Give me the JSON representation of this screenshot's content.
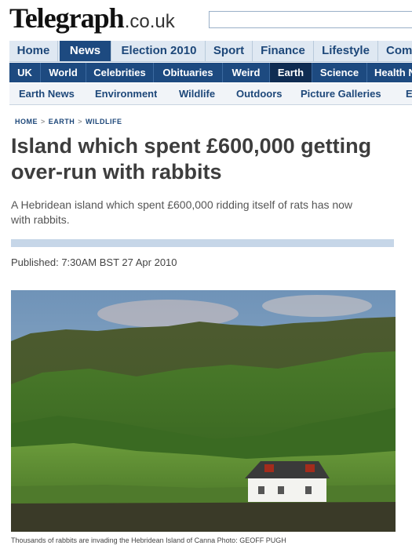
{
  "masthead": {
    "logo_text": "Telegraph",
    "logo_tld": ".co.uk",
    "search": {
      "value": "",
      "placeholder": ""
    }
  },
  "nav_primary": [
    {
      "label": "Home",
      "active": false
    },
    {
      "label": "News",
      "active": true
    },
    {
      "label": "Election 2010",
      "active": false
    },
    {
      "label": "Sport",
      "active": false
    },
    {
      "label": "Finance",
      "active": false
    },
    {
      "label": "Lifestyle",
      "active": false
    },
    {
      "label": "Comm",
      "active": false
    }
  ],
  "nav_secondary": [
    {
      "label": "UK",
      "active": false
    },
    {
      "label": "World",
      "active": false
    },
    {
      "label": "Celebrities",
      "active": false
    },
    {
      "label": "Obituaries",
      "active": false
    },
    {
      "label": "Weird",
      "active": false
    },
    {
      "label": "Earth",
      "active": true
    },
    {
      "label": "Science",
      "active": false
    },
    {
      "label": "Health N",
      "active": false
    }
  ],
  "nav_tertiary": [
    {
      "label": "Earth News"
    },
    {
      "label": "Environment"
    },
    {
      "label": "Wildlife"
    },
    {
      "label": "Outdoors"
    },
    {
      "label": "Picture Galleries"
    },
    {
      "label": "E"
    }
  ],
  "breadcrumb": [
    "HOME",
    "EARTH",
    "WILDLIFE"
  ],
  "article": {
    "headline_line1": "Island which spent £600,000 getting",
    "headline_line2": "over-run with rabbits",
    "standfirst_line1": "A Hebridean island which spent £600,000 ridding itself of rats has now",
    "standfirst_line2": "with rabbits.",
    "published": "Published: 7:30AM BST 27 Apr 2010",
    "photo_caption": "Thousands of rabbits are invading the Hebridean Island of Canna   Photo: GEOFF PUGH"
  },
  "colors": {
    "nav_primary_active": "#1d4a80",
    "nav_secondary_bg": "#1d4a80",
    "link_blue": "#1d4779"
  }
}
